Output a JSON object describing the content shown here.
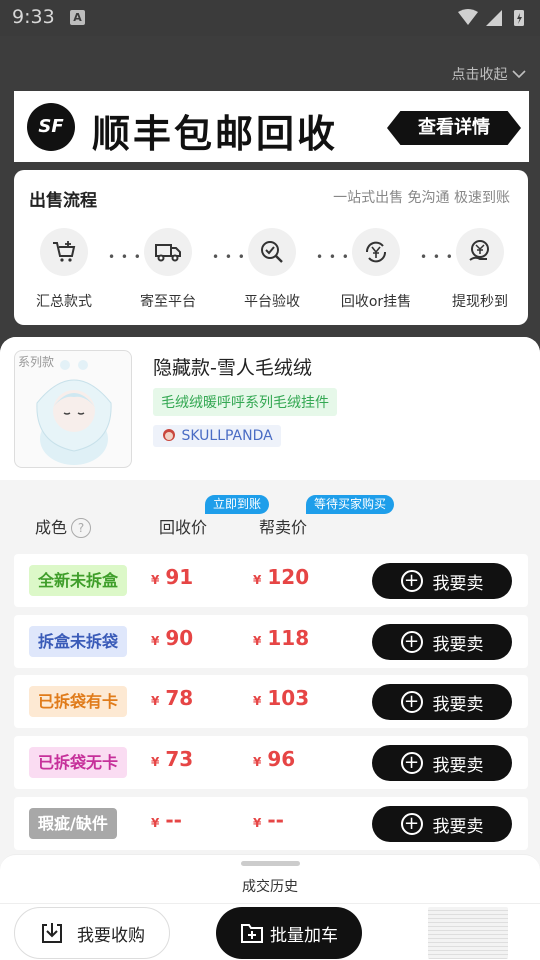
{
  "status": {
    "time": "9:33",
    "app_badge": "A"
  },
  "collapse_label": "点击收起",
  "banner": {
    "logo_text": "SF",
    "title": "顺丰包邮回收",
    "detail_button": "查看详情"
  },
  "process": {
    "title": "出售流程",
    "subtitle": "一站式出售 免沟通 极速到账",
    "steps": [
      {
        "label": "汇总款式",
        "icon": "cart-add-icon"
      },
      {
        "label": "寄至平台",
        "icon": "delivery-truck-icon"
      },
      {
        "label": "平台验收",
        "icon": "inspect-check-icon"
      },
      {
        "label": "回收or挂售",
        "icon": "yen-cycle-icon"
      },
      {
        "label": "提现秒到",
        "icon": "yen-hand-icon"
      }
    ]
  },
  "product": {
    "image_tag": "系列款",
    "name": "隐藏款-雪人毛绒绒",
    "series": "毛绒绒暖呼呼系列毛绒挂件",
    "brand": "SKULLPANDA"
  },
  "table": {
    "col_condition": "成色",
    "col_condition_help": "?",
    "col_recycle": "回收价",
    "col_consign": "帮卖价",
    "pill_instant": "立即到账",
    "pill_wait": "等待买家购买",
    "currency": "¥",
    "sell_label": "我要卖",
    "rows": [
      {
        "condition": "全新未拆盒",
        "recycle": "91",
        "consign": "120",
        "fg": "#3f9e2a",
        "bg": "#dcf8c8"
      },
      {
        "condition": "拆盒未拆袋",
        "recycle": "90",
        "consign": "118",
        "fg": "#3a5bb8",
        "bg": "#dfe7fb"
      },
      {
        "condition": "已拆袋有卡",
        "recycle": "78",
        "consign": "103",
        "fg": "#e07b1a",
        "bg": "#fde9d3"
      },
      {
        "condition": "已拆袋无卡",
        "recycle": "73",
        "consign": "96",
        "fg": "#c6309a",
        "bg": "#fadcf2"
      },
      {
        "condition": "瑕疵/缺件",
        "recycle": "--",
        "consign": "--",
        "fg": "#ffffff",
        "bg": "#a8a8a8"
      }
    ]
  },
  "history_label": "成交历史",
  "bottom": {
    "want_buy": "我要收购",
    "batch_add": "批量加车"
  }
}
